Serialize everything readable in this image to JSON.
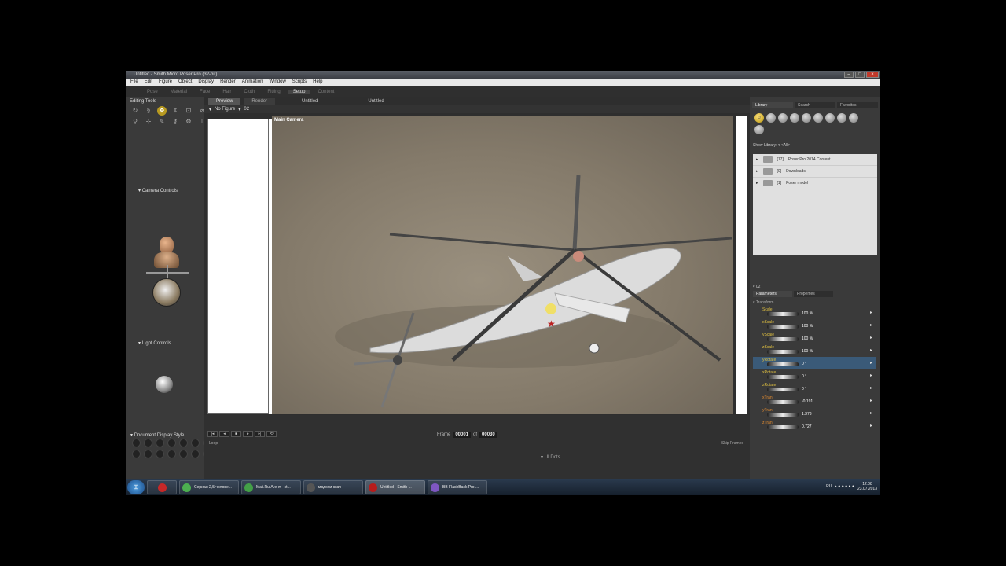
{
  "window": {
    "title": "Untitled - Smith Micro Poser Pro (32-bit)",
    "controls": [
      "–",
      "□",
      "×"
    ]
  },
  "menu": [
    "File",
    "Edit",
    "Figure",
    "Object",
    "Display",
    "Render",
    "Animation",
    "Window",
    "Scripts",
    "Help"
  ],
  "rooms": [
    "Pose",
    "Material",
    "Face",
    "Hair",
    "Cloth",
    "Fitting",
    "Setup",
    "Content"
  ],
  "active_room": "Setup",
  "left_panel": {
    "editing_tools_title": "Editing Tools",
    "camera_controls_title": "Camera Controls",
    "light_controls_title": "Light Controls",
    "document_display_style_title": "Document Display Style"
  },
  "viewport": {
    "tabs": [
      "Preview",
      "Render"
    ],
    "active_tab": "Preview",
    "doc_titles": [
      "Untitled",
      "Untitled"
    ],
    "figure_select": "No Figure",
    "actor_select": "02",
    "camera_label": "Main Camera"
  },
  "timeline": {
    "frame_label": "Frame",
    "current_frame": "00001",
    "of_label": "of",
    "total_frames": "00030",
    "loop_label": "Loop",
    "skip_frames_label": "Skip Frames",
    "ui_dots_label": "UI Dots"
  },
  "library": {
    "tabs": [
      "Library",
      "Search",
      "Favorites"
    ],
    "active_tab": "Library",
    "show_library_label": "Show Library:",
    "show_library_value": "<All>",
    "folders": [
      {
        "count": "[17]",
        "name": "Poser Pro 2014 Content"
      },
      {
        "count": "[0]",
        "name": "Downloads"
      },
      {
        "count": "[1]",
        "name": "Poser model"
      }
    ]
  },
  "parameters": {
    "actor": "02",
    "tabs": [
      "Parameters",
      "Properties"
    ],
    "active_tab": "Parameters",
    "group": "Transform",
    "rows": [
      {
        "label": "Scale",
        "value": "100 %",
        "kind": "rot"
      },
      {
        "label": "xScale",
        "value": "100 %",
        "kind": "rot"
      },
      {
        "label": "yScale",
        "value": "100 %",
        "kind": "rot"
      },
      {
        "label": "zScale",
        "value": "100 %",
        "kind": "rot"
      },
      {
        "label": "yRotate",
        "value": "0 °",
        "kind": "rot",
        "selected": true
      },
      {
        "label": "xRotate",
        "value": "0 °",
        "kind": "rot"
      },
      {
        "label": "zRotate",
        "value": "0 °",
        "kind": "rot"
      },
      {
        "label": "xTran",
        "value": "-0.191",
        "kind": "trans"
      },
      {
        "label": "yTran",
        "value": "1.373",
        "kind": "trans"
      },
      {
        "label": "zTran",
        "value": "0.727",
        "kind": "trans"
      }
    ]
  },
  "taskbar": {
    "items": [
      {
        "label": "",
        "color": "#c62828",
        "narrow": true
      },
      {
        "label": "Сериал 2,5 челове...",
        "color": "#4caf50"
      },
      {
        "label": "Mail.Ru Агент - st...",
        "color": "#43a047"
      },
      {
        "label": "модели скач",
        "color": "#555555"
      },
      {
        "label": "Untitled - Smith ...",
        "color": "#b71c1c",
        "active": true
      },
      {
        "label": "BB FlashBack Pro ...",
        "color": "#7e57c2"
      }
    ],
    "lang": "RU",
    "time": "12:08",
    "date": "23.07.2013"
  },
  "colors": {
    "accent": "#b89a21",
    "selection": "#3a5a78"
  }
}
